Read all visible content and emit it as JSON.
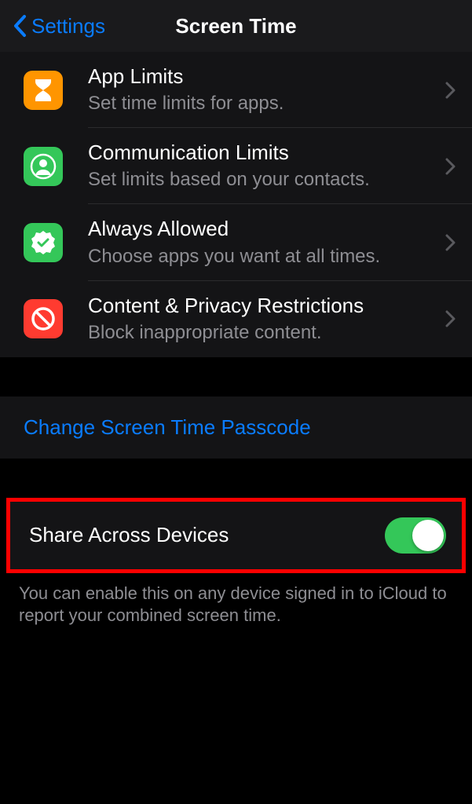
{
  "nav": {
    "back_label": "Settings",
    "title": "Screen Time"
  },
  "rows": [
    {
      "icon": "hourglass",
      "title": "App Limits",
      "subtitle": "Set time limits for apps."
    },
    {
      "icon": "person-circle",
      "title": "Communication Limits",
      "subtitle": "Set limits based on your contacts."
    },
    {
      "icon": "checkmark-seal",
      "title": "Always Allowed",
      "subtitle": "Choose apps you want at all times."
    },
    {
      "icon": "no-entry",
      "title": "Content & Privacy Restrictions",
      "subtitle": "Block inappropriate content."
    }
  ],
  "link": {
    "label": "Change Screen Time Passcode"
  },
  "share": {
    "label": "Share Across Devices",
    "enabled": true
  },
  "footer": "You can enable this on any device signed in to iCloud to report your combined screen time."
}
